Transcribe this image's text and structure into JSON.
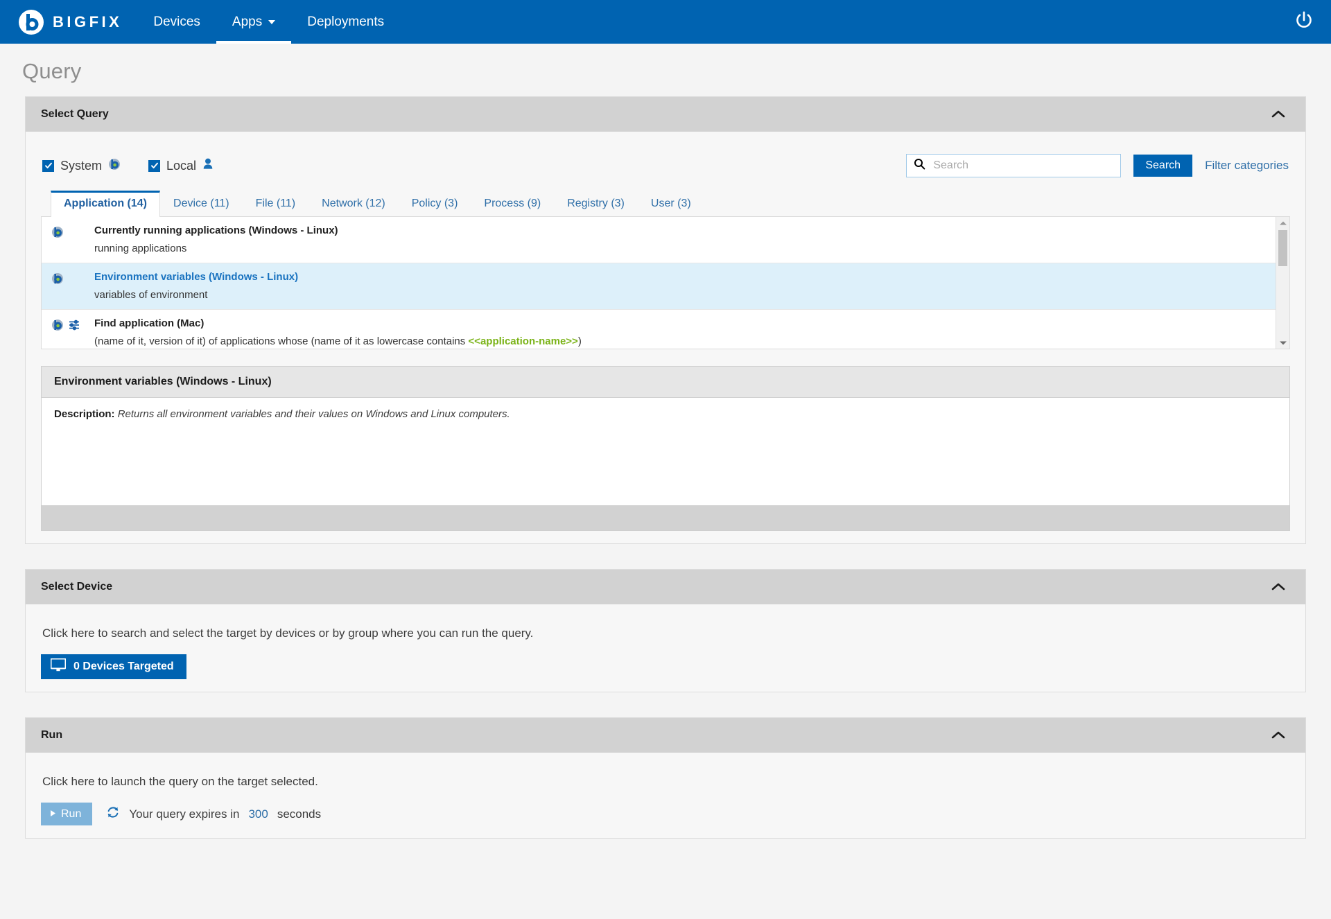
{
  "navbar": {
    "brand": "BIGFIX",
    "brand_logo_icon": "bigfix-logo-icon",
    "items": [
      {
        "label": "Devices",
        "active": false,
        "caret": false
      },
      {
        "label": "Apps",
        "active": true,
        "caret": true
      },
      {
        "label": "Deployments",
        "active": false,
        "caret": false
      }
    ],
    "power_icon": "power-icon",
    "background": "#0063b1"
  },
  "page": {
    "title": "Query"
  },
  "select_query": {
    "header": "Select Query",
    "collapse_icon": "chevron-up-icon",
    "filters": [
      {
        "label": "System",
        "checked": true,
        "icon": "bigfix-globe-icon"
      },
      {
        "label": "Local",
        "checked": true,
        "icon": "user-icon"
      }
    ],
    "search": {
      "placeholder": "Search",
      "value": "",
      "icon": "search-icon",
      "button_label": "Search",
      "filter_link": "Filter categories"
    },
    "tabs": [
      {
        "label": "Application (14)",
        "active": true
      },
      {
        "label": "Device (11)",
        "active": false
      },
      {
        "label": "File (11)",
        "active": false
      },
      {
        "label": "Network (12)",
        "active": false
      },
      {
        "label": "Policy (3)",
        "active": false
      },
      {
        "label": "Process (9)",
        "active": false
      },
      {
        "label": "Registry (3)",
        "active": false
      },
      {
        "label": "User (3)",
        "active": false
      }
    ],
    "rows": [
      {
        "title": "Currently running applications (Windows - Linux)",
        "desc_prefix": "running applications",
        "param": "",
        "desc_suffix": "",
        "selected": false,
        "has_param_icon": false
      },
      {
        "title": "Environment variables (Windows - Linux)",
        "desc_prefix": "variables of environment",
        "param": "",
        "desc_suffix": "",
        "selected": true,
        "has_param_icon": false
      },
      {
        "title": "Find application (Mac)",
        "desc_prefix": "(name of it, version of it) of applications whose (name of it as lowercase contains ",
        "param": "<<application-name>>",
        "desc_suffix": ")",
        "selected": false,
        "has_param_icon": true
      }
    ],
    "scrollbar": {
      "up_icon": "scroll-up-arrow-icon",
      "down_icon": "scroll-down-arrow-icon"
    },
    "description": {
      "title": "Environment variables (Windows - Linux)",
      "label": "Description:",
      "text": "Returns all environment variables and their values on Windows and Linux computers."
    }
  },
  "select_device": {
    "header": "Select Device",
    "collapse_icon": "chevron-up-icon",
    "instruction": "Click here to search and select the target by devices or by group where you can run the query.",
    "button_label": "0 Devices Targeted",
    "button_icon": "monitor-icon"
  },
  "run": {
    "header": "Run",
    "collapse_icon": "chevron-up-icon",
    "instruction": "Click here to launch the query on the target selected.",
    "button_label": "Run",
    "refresh_icon": "refresh-icon",
    "expire_prefix": "Your query expires in",
    "expire_seconds": "300",
    "expire_suffix": "seconds"
  }
}
